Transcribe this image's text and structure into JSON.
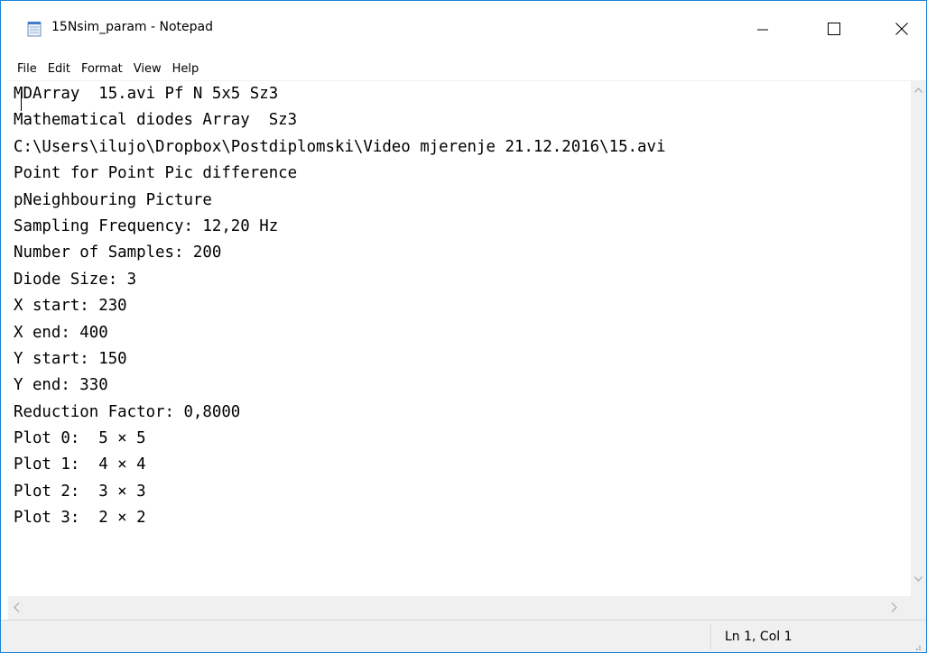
{
  "window": {
    "title": "15Nsim_param - Notepad",
    "accent_color": "#1883d7"
  },
  "menu": {
    "items": [
      "File",
      "Edit",
      "Format",
      "View",
      "Help"
    ]
  },
  "editor": {
    "lines": [
      "MDArray  15.avi Pf N 5x5 Sz3",
      "Mathematical diodes Array  Sz3",
      "C:\\Users\\ilujo\\Dropbox\\Postdiplomski\\Video mjerenje 21.12.2016\\15.avi",
      "Point for Point Pic difference",
      "pNeighbouring Picture",
      "Sampling Frequency: 12,20 Hz",
      "Number of Samples: 200",
      "Diode Size: 3",
      "X start: 230",
      "X end: 400",
      "Y start: 150",
      "Y end: 330",
      "Reduction Factor: 0,8000",
      "Plot 0:  5 × 5",
      "Plot 1:  4 × 4",
      "Plot 2:  3 × 3",
      "Plot 3:  2 × 2"
    ]
  },
  "status": {
    "position": "Ln 1, Col 1"
  },
  "icons": {
    "app": "notepad-icon",
    "minimize": "minimize-icon",
    "maximize": "maximize-icon",
    "close": "close-icon"
  }
}
